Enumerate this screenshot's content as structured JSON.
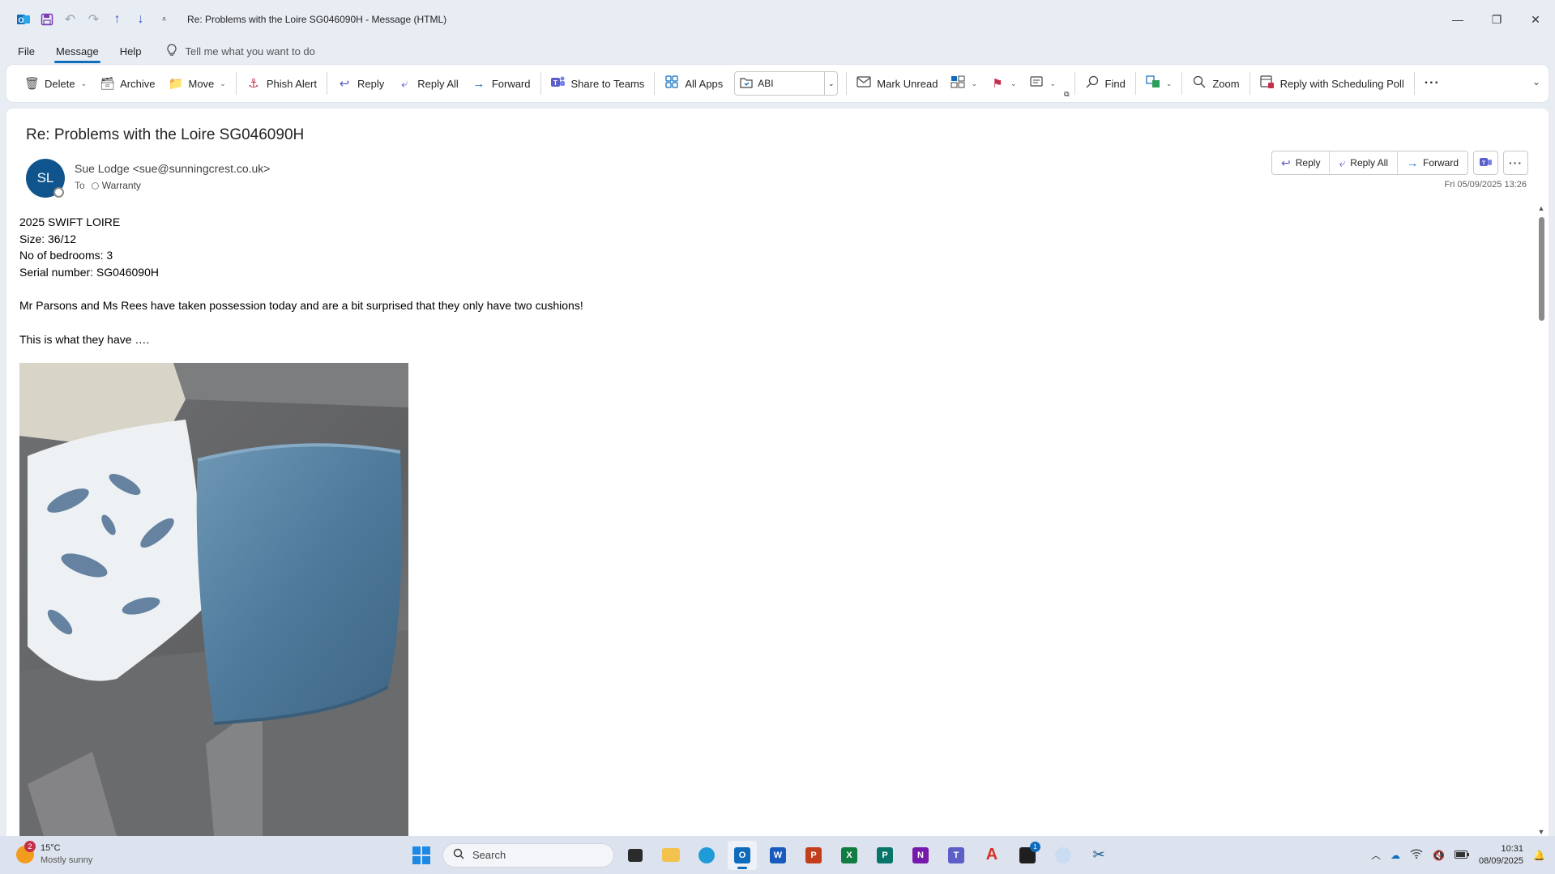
{
  "window": {
    "title": "Re: Problems with the Loire SG046090H  -  Message (HTML)",
    "controls": {
      "minimize": "—",
      "restore": "❐",
      "close": "✕"
    }
  },
  "quick_access": [
    {
      "name": "outlook-app-icon",
      "glyph": "O"
    },
    {
      "name": "save-icon",
      "glyph": "💾"
    },
    {
      "name": "undo-icon",
      "glyph": "↶"
    },
    {
      "name": "redo-icon",
      "glyph": "↷"
    },
    {
      "name": "previous-item-icon",
      "glyph": "↑"
    },
    {
      "name": "next-item-icon",
      "glyph": "↓"
    },
    {
      "name": "customize-qat-icon",
      "glyph": "⩡"
    }
  ],
  "menu": {
    "file": "File",
    "message": "Message",
    "help": "Help",
    "tell_me": "Tell me what you want to do"
  },
  "ribbon": {
    "delete": "Delete",
    "archive": "Archive",
    "move": "Move",
    "phish_alert": "Phish Alert",
    "reply": "Reply",
    "reply_all": "Reply All",
    "forward": "Forward",
    "share_to_teams": "Share to Teams",
    "all_apps": "All Apps",
    "abi": "ABI",
    "mark_unread": "Mark Unread",
    "find": "Find",
    "zoom": "Zoom",
    "reply_with_poll": "Reply with Scheduling Poll",
    "more": "···"
  },
  "message": {
    "subject": "Re: Problems with the Loire SG046090H",
    "avatar_initials": "SL",
    "sender": "Sue Lodge <sue@sunningcrest.co.uk>",
    "to_label": "To",
    "recipient": "Warranty",
    "datetime": "Fri 05/09/2025 13:26",
    "actions": {
      "reply": "Reply",
      "reply_all": "Reply All",
      "forward": "Forward"
    },
    "body": {
      "line1": "2025 SWIFT LOIRE",
      "line2": "Size: 36/12",
      "line3": "No of bedrooms: 3",
      "line4": "Serial number: SG046090H",
      "para1": "Mr Parsons and Ms Rees have taken possession today and are a bit surprised that they only have two cushions!",
      "para2": "This is what they have …."
    }
  },
  "taskbar": {
    "weather_temp": "15°C",
    "weather_condition": "Mostly sunny",
    "weather_badge": "2",
    "search_placeholder": "Search",
    "mail_badge": "1",
    "time": "10:31",
    "date": "08/09/2025"
  },
  "colors": {
    "accent": "#0f6cbd",
    "avatar_bg": "#0f548c",
    "teams_purple": "#5b5fc7",
    "background": "#e8ecf3"
  }
}
